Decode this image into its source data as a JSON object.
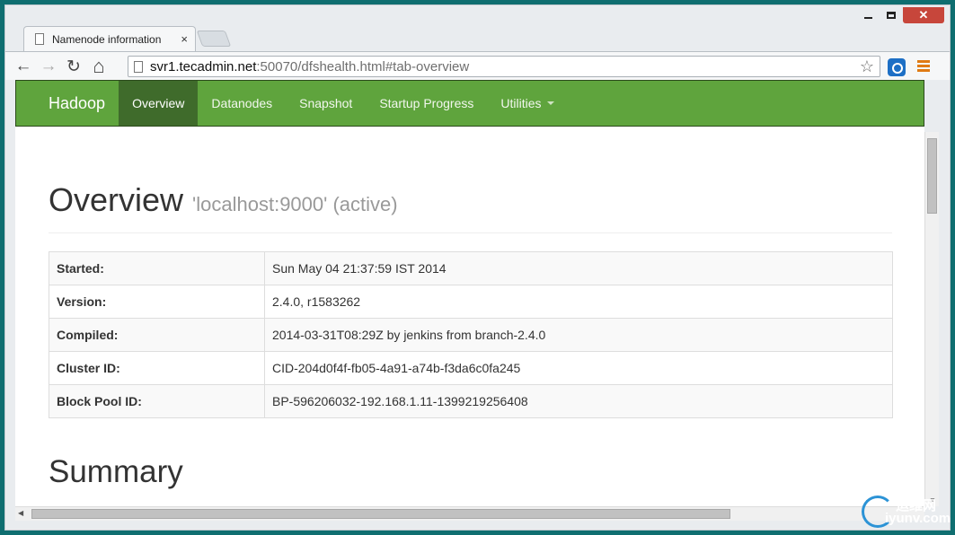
{
  "browser": {
    "tab_title": "Namenode information",
    "tab_close": "×",
    "url_host": "svr1.tecadmin.net",
    "url_path": ":50070/dfshealth.html#tab-overview",
    "back": "←",
    "forward": "→",
    "reload": "↻",
    "home": "⌂",
    "bookmark_star": "☆",
    "window_close": "✕"
  },
  "navbar": {
    "brand": "Hadoop",
    "items": [
      {
        "label": "Overview",
        "active": true
      },
      {
        "label": "Datanodes"
      },
      {
        "label": "Snapshot"
      },
      {
        "label": "Startup Progress"
      },
      {
        "label": "Utilities",
        "dropdown": true
      }
    ]
  },
  "overview": {
    "title": "Overview",
    "subtitle": "'localhost:9000' (active)",
    "rows": [
      {
        "label": "Started:",
        "value": "Sun May 04 21:37:59 IST 2014"
      },
      {
        "label": "Version:",
        "value": "2.4.0, r1583262"
      },
      {
        "label": "Compiled:",
        "value": "2014-03-31T08:29Z by jenkins from branch-2.4.0"
      },
      {
        "label": "Cluster ID:",
        "value": "CID-204d0f4f-fb05-4a91-a74b-f3da6c0fa245"
      },
      {
        "label": "Block Pool ID:",
        "value": "BP-596206032-192.168.1.11-1399219256408"
      }
    ]
  },
  "summary": {
    "title": "Summary"
  },
  "watermark": {
    "cn": "运维网",
    "en": "iyunv.com"
  }
}
